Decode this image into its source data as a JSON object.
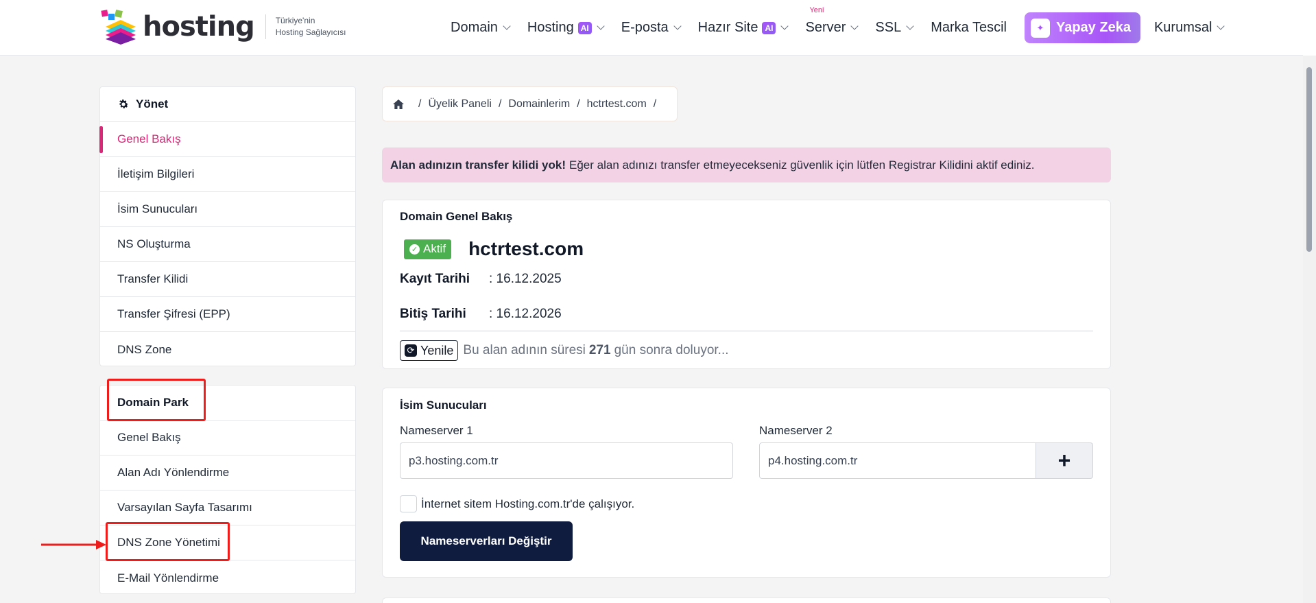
{
  "header": {
    "logo_text": "hosting",
    "tagline_line1": "Türkiye'nin",
    "tagline_line2": "Hosting Sağlayıcısı",
    "nav": [
      {
        "label": "Domain"
      },
      {
        "label": "Hosting",
        "badge": "AI"
      },
      {
        "label": "E-posta"
      },
      {
        "label": "Hazır Site",
        "badge": "AI"
      },
      {
        "label": "Server",
        "tag": "Yeni"
      },
      {
        "label": "SSL"
      },
      {
        "label": "Marka Tescil"
      },
      {
        "label": "Yapay Zeka"
      },
      {
        "label": "Kurumsal"
      }
    ]
  },
  "sidebar": {
    "manage": {
      "title": "Yönet",
      "items": [
        "Genel Bakış",
        "İletişim Bilgileri",
        "İsim Sunucuları",
        "NS Oluşturma",
        "Transfer Kilidi",
        "Transfer Şifresi (EPP)",
        "DNS Zone"
      ]
    },
    "park": {
      "title": "Domain Park",
      "items": [
        "Genel Bakış",
        "Alan Adı Yönlendirme",
        "Varsayılan Sayfa Tasarımı",
        "DNS Zone Yönetimi",
        "E-Mail Yönlendirme"
      ]
    }
  },
  "breadcrumb": {
    "items": [
      "Üyelik Paneli",
      "Domainlerim",
      "hctrtest.com"
    ]
  },
  "alert": {
    "bold": "Alan adınızın transfer kilidi yok!",
    "text": "Eğer alan adınızı transfer etmeyecekseniz güvenlik için lütfen Registrar Kilidini aktif ediniz."
  },
  "overview": {
    "title": "Domain Genel Bakış",
    "status": "Aktif",
    "domain": "hctrtest.com",
    "reg_label": "Kayıt Tarihi",
    "reg_value": ": 16.12.2025",
    "exp_label": "Bitiş Tarihi",
    "exp_value": ": 16.12.2026",
    "renew_label": "Yenile",
    "renew_pre": "Bu alan adının süresi",
    "renew_days": "271",
    "renew_post": "gün sonra doluyor..."
  },
  "nameservers": {
    "title": "İsim Sunucuları",
    "ns1_label": "Nameserver 1",
    "ns1_value": "p3.hosting.com.tr",
    "ns2_label": "Nameserver 2",
    "ns2_value": "p4.hosting.com.tr",
    "checkbox_label": "İnternet sitem Hosting.com.tr'de çalışıyor.",
    "submit_label": "Nameserverları Değiştir"
  },
  "colors": {
    "accent": "#db2777",
    "alert_bg": "#f3d2e6",
    "status_green": "#4caf50",
    "primary_dark": "#0f1c3f",
    "annotation_red": "#ef1c1c"
  }
}
